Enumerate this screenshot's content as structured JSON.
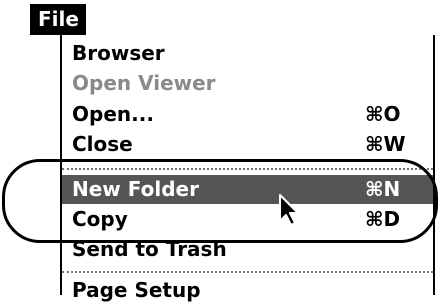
{
  "menu": {
    "title": "File",
    "items": [
      {
        "label": "Browser",
        "shortcut": ""
      },
      {
        "label": "Open Viewer",
        "shortcut": ""
      },
      {
        "label": "Open...",
        "shortcut": "⌘O"
      },
      {
        "label": "Close",
        "shortcut": "⌘W"
      },
      {
        "label": "New Folder",
        "shortcut": "⌘N"
      },
      {
        "label": "Copy",
        "shortcut": "⌘D"
      },
      {
        "label": "Send to Trash",
        "shortcut": ""
      },
      {
        "label": "Page Setup",
        "shortcut": ""
      }
    ]
  },
  "colors": {
    "menu_bar_bg": "#000000",
    "selected_bg": "#555555",
    "disabled_text": "#8a8a8a"
  },
  "icons": {
    "cursor": "arrow-cursor-icon"
  }
}
